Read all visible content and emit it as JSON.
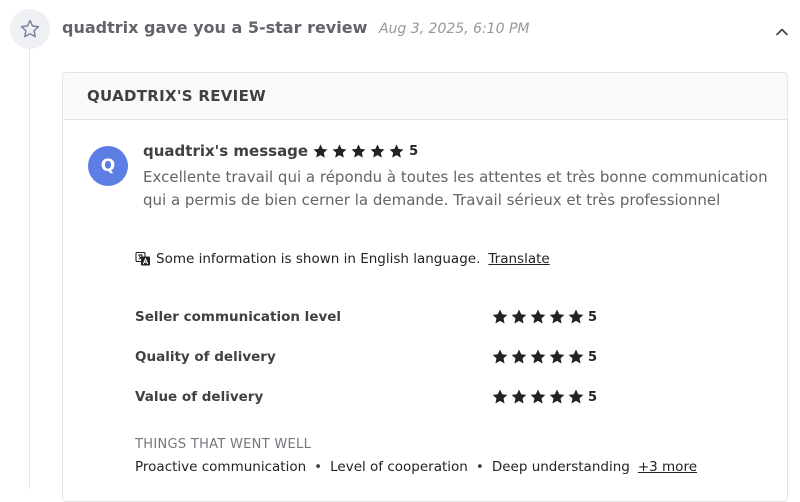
{
  "event": {
    "title": "quadtrix gave you a 5-star review",
    "time": "Aug 3, 2025, 6:10 PM"
  },
  "card": {
    "header": "QUADTRIX'S REVIEW"
  },
  "message": {
    "avatar_letter": "Q",
    "author": "quadtrix's message",
    "rating": "5",
    "text": "Excellente travail qui a répondu à toutes les attentes et très bonne communication qui a permis de bien cerner la demande. Travail sérieux et très professionnel"
  },
  "translate": {
    "notice": "Some information is shown in English language.",
    "link": "Translate"
  },
  "ratings": [
    {
      "label": "Seller communication level",
      "value": "5"
    },
    {
      "label": "Quality of delivery",
      "value": "5"
    },
    {
      "label": "Value of delivery",
      "value": "5"
    }
  ],
  "went_well": {
    "title": "THINGS THAT WENT WELL",
    "items": [
      "Proactive communication",
      "Level of cooperation",
      "Deep understanding"
    ],
    "more": "+3 more"
  },
  "colors": {
    "avatar_bg": "#5d7ee4",
    "star": "#222325",
    "icon_circle": "#eef0f4"
  },
  "icons": {
    "event": "star-outline-icon",
    "collapse": "chevron-up-icon",
    "translate": "translate-icon",
    "rating": "star-icon"
  }
}
